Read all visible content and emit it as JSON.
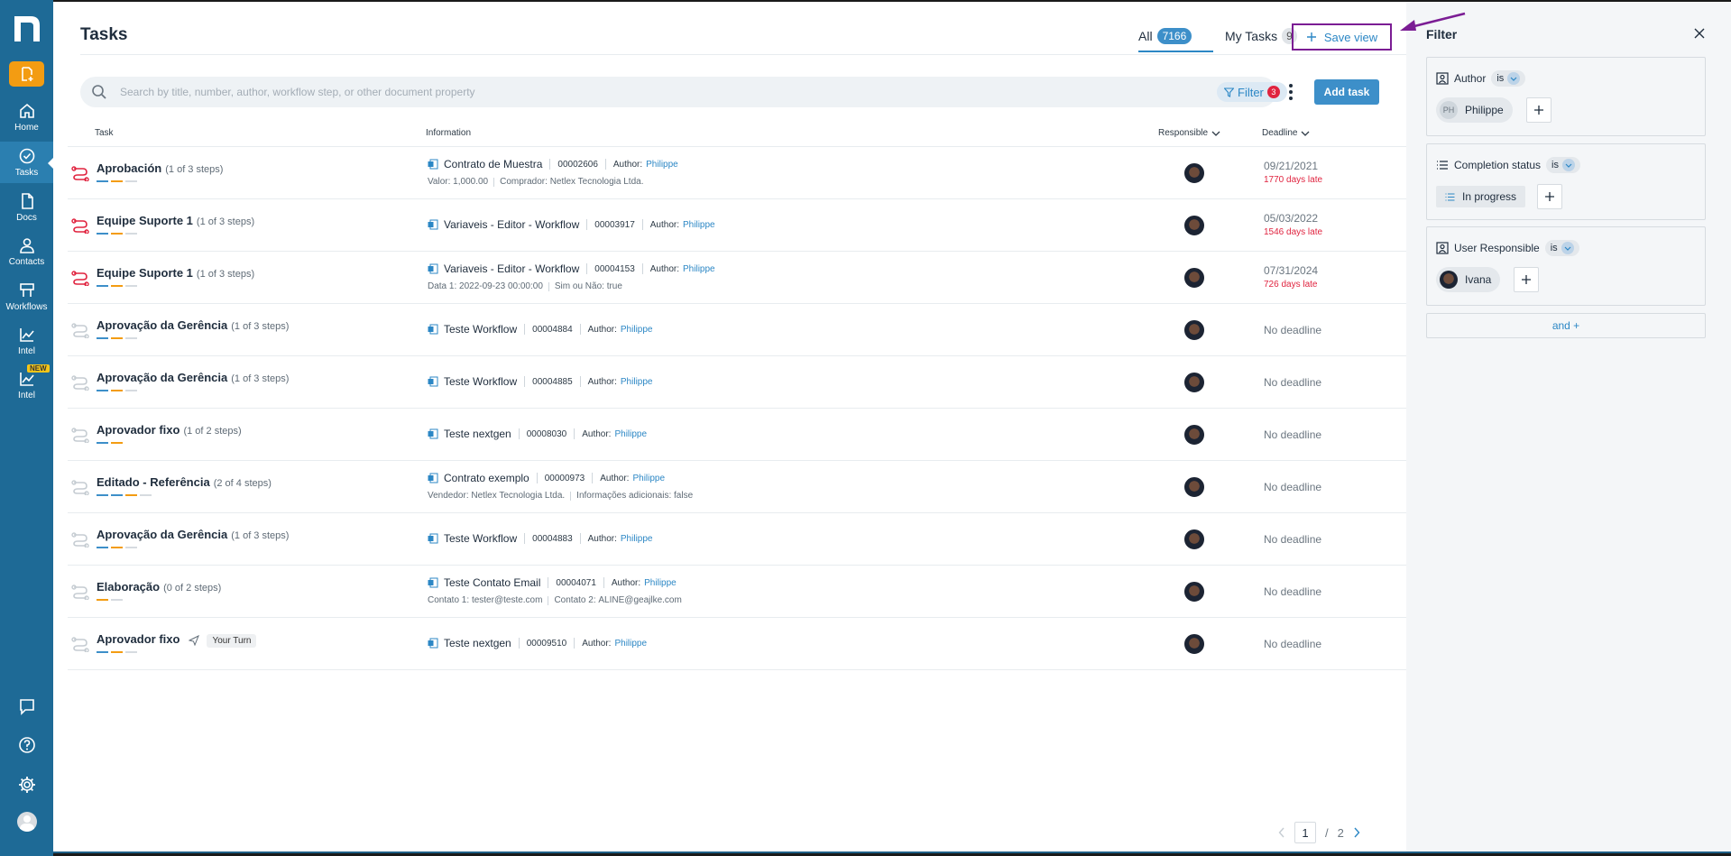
{
  "sidebar": {
    "items": [
      {
        "label": "Home",
        "icon": "home-icon"
      },
      {
        "label": "Tasks",
        "icon": "tasks-icon"
      },
      {
        "label": "Docs",
        "icon": "docs-icon"
      },
      {
        "label": "Contacts",
        "icon": "contacts-icon"
      },
      {
        "label": "Workflows",
        "icon": "workflows-icon"
      },
      {
        "label": "Intel",
        "icon": "intel-icon"
      },
      {
        "label": "Intel",
        "icon": "intel-new-icon",
        "badge": "NEW"
      }
    ]
  },
  "header": {
    "title": "Tasks",
    "tab_all": "All",
    "tab_all_count": "7166",
    "tab_my": "My Tasks",
    "tab_my_count": "9",
    "save_view": "Save view"
  },
  "search": {
    "placeholder": "Search by title, number, author, workflow step, or other document property",
    "filter_label": "Filter",
    "filter_count": "3",
    "add_task": "Add task"
  },
  "columns": {
    "task": "Task",
    "information": "Information",
    "responsible": "Responsible",
    "deadline": "Deadline"
  },
  "rows": [
    {
      "name": "Aprobación",
      "steps": "(1 of 3 steps)",
      "doc": "Contrato de Muestra",
      "number": "00002606",
      "author_label": "Author:",
      "author": "Philippe",
      "line2": [
        {
          "k": "Valor:",
          "v": "1,000.00"
        },
        {
          "k": "Comprador:",
          "v": "Netlex Tecnologia Ltda."
        }
      ],
      "deadline": "09/21/2021",
      "late": "1770 days late"
    },
    {
      "name": "Equipe Suporte 1",
      "steps": "(1 of 3 steps)",
      "doc": "Variaveis - Editor - Workflow",
      "number": "00003917",
      "author_label": "Author:",
      "author": "Philippe",
      "line2": [],
      "deadline": "05/03/2022",
      "late": "1546 days late"
    },
    {
      "name": "Equipe Suporte 1",
      "steps": "(1 of 3 steps)",
      "doc": "Variaveis - Editor - Workflow",
      "number": "00004153",
      "author_label": "Author:",
      "author": "Philippe",
      "line2": [
        {
          "k": "Data 1:",
          "v": "2022-09-23 00:00:00"
        },
        {
          "k": "Sim ou Não:",
          "v": "true"
        }
      ],
      "deadline": "07/31/2024",
      "late": "726 days late"
    },
    {
      "name": "Aprovação da Gerência",
      "steps": "(1 of 3 steps)",
      "doc": "Teste Workflow",
      "number": "00004884",
      "author_label": "Author:",
      "author": "Philippe",
      "line2": [],
      "deadline": "No deadline",
      "late": ""
    },
    {
      "name": "Aprovação da Gerência",
      "steps": "(1 of 3 steps)",
      "doc": "Teste Workflow",
      "number": "00004885",
      "author_label": "Author:",
      "author": "Philippe",
      "line2": [],
      "deadline": "No deadline",
      "late": ""
    },
    {
      "name": "Aprovador fixo",
      "steps": "(1 of 2 steps)",
      "doc": "Teste nextgen",
      "number": "00008030",
      "author_label": "Author:",
      "author": "Philippe",
      "line2": [],
      "deadline": "No deadline",
      "late": ""
    },
    {
      "name": "Editado - Referência",
      "steps": "(2 of 4 steps)",
      "doc": "Contrato exemplo",
      "number": "00000973",
      "author_label": "Author:",
      "author": "Philippe",
      "line2": [
        {
          "k": "Vendedor:",
          "v": "Netlex Tecnologia Ltda."
        },
        {
          "k": "Informações adicionais:",
          "v": "false"
        }
      ],
      "deadline": "No deadline",
      "late": ""
    },
    {
      "name": "Aprovação da Gerência",
      "steps": "(1 of 3 steps)",
      "doc": "Teste Workflow",
      "number": "00004883",
      "author_label": "Author:",
      "author": "Philippe",
      "line2": [],
      "deadline": "No deadline",
      "late": ""
    },
    {
      "name": "Elaboração",
      "steps": "(0 of 2 steps)",
      "doc": "Teste Contato Email",
      "number": "00004071",
      "author_label": "Author:",
      "author": "Philippe",
      "line2": [
        {
          "k": "Contato 1:",
          "v": "tester@teste.com"
        },
        {
          "k": "Contato 2:",
          "v": "ALINE@geajlke.com"
        }
      ],
      "deadline": "No deadline",
      "late": ""
    },
    {
      "name": "Aprovador fixo",
      "steps": "",
      "your_turn": "Your Turn",
      "doc": "Teste nextgen",
      "number": "00009510",
      "author_label": "Author:",
      "author": "Philippe",
      "line2": [],
      "deadline": "No deadline",
      "late": ""
    }
  ],
  "pagination": {
    "current": "1",
    "separator": "/",
    "total": "2"
  },
  "filter_panel": {
    "title": "Filter",
    "author_label": "Author",
    "author_op": "is",
    "author_initials": "PH",
    "author_value": "Philippe",
    "completion_label": "Completion status",
    "completion_op": "is",
    "completion_value": "In progress",
    "responsible_label": "User Responsible",
    "responsible_op": "is",
    "responsible_value": "Ivana",
    "and_plus": "and +"
  },
  "colors": {
    "sidebar": "#1e6a96",
    "accent": "#2c87c5",
    "late": "#e0233f",
    "highlight_box": "#7b1d94",
    "orange": "#f39c12"
  }
}
